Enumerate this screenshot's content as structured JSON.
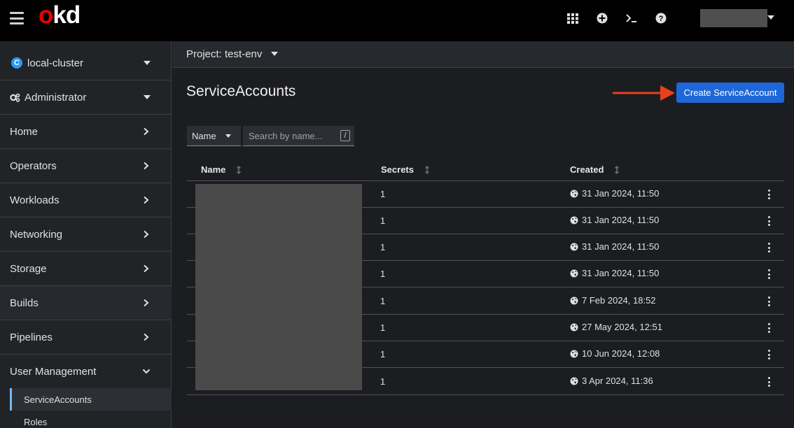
{
  "masthead": {
    "logo_o": "o",
    "logo_kd": "kd",
    "icons": [
      "grid-icon",
      "plus-circle-icon",
      "terminal-icon",
      "question-circle-icon"
    ]
  },
  "sidebar": {
    "cluster": {
      "badge": "C",
      "label": "local-cluster"
    },
    "perspective": {
      "label": "Administrator"
    },
    "items": [
      {
        "label": "Home"
      },
      {
        "label": "Operators"
      },
      {
        "label": "Workloads"
      },
      {
        "label": "Networking"
      },
      {
        "label": "Storage"
      },
      {
        "label": "Builds"
      },
      {
        "label": "Pipelines"
      },
      {
        "label": "User Management"
      }
    ],
    "sub_items": [
      {
        "label": "ServiceAccounts"
      },
      {
        "label": "Roles"
      }
    ]
  },
  "project": {
    "label": "Project: test-env"
  },
  "page": {
    "title": "ServiceAccounts",
    "create_button": "Create ServiceAccount"
  },
  "filter": {
    "type": "Name",
    "placeholder": "Search by name...",
    "shortcut": "/"
  },
  "table": {
    "headers": {
      "name": "Name",
      "secrets": "Secrets",
      "created": "Created"
    },
    "rows": [
      {
        "secrets": "1",
        "created": "31 Jan 2024, 11:50"
      },
      {
        "secrets": "1",
        "created": "31 Jan 2024, 11:50"
      },
      {
        "secrets": "1",
        "created": "31 Jan 2024, 11:50"
      },
      {
        "secrets": "1",
        "created": "31 Jan 2024, 11:50"
      },
      {
        "secrets": "1",
        "created": "7 Feb 2024, 18:52"
      },
      {
        "secrets": "1",
        "created": "27 May 2024, 12:51"
      },
      {
        "secrets": "1",
        "created": "10 Jun 2024, 12:08"
      },
      {
        "secrets": "1",
        "created": "3 Apr 2024, 11:36"
      }
    ]
  },
  "colors": {
    "accent": "#1f67d8",
    "logo_red": "#ee0000",
    "annotation_arrow": "#e8401c",
    "active_nav": "#73bcf7"
  }
}
